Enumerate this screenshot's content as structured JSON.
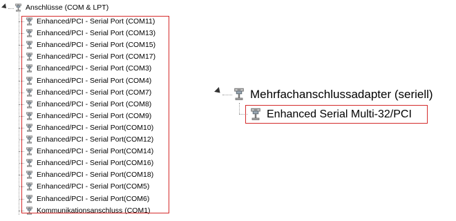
{
  "left_tree": {
    "parent_label": "Anschlüsse (COM & LPT)",
    "children": [
      "Enhanced/PCI - Serial Port (COM11)",
      "Enhanced/PCI - Serial Port (COM13)",
      "Enhanced/PCI - Serial Port (COM15)",
      "Enhanced/PCI - Serial Port (COM17)",
      "Enhanced/PCI - Serial Port (COM3)",
      "Enhanced/PCI - Serial Port (COM4)",
      "Enhanced/PCI - Serial Port (COM7)",
      "Enhanced/PCI - Serial Port (COM8)",
      "Enhanced/PCI - Serial Port (COM9)",
      "Enhanced/PCI - Serial Port(COM10)",
      "Enhanced/PCI - Serial Port(COM12)",
      "Enhanced/PCI - Serial Port(COM14)",
      "Enhanced/PCI - Serial Port(COM16)",
      "Enhanced/PCI - Serial Port(COM18)",
      "Enhanced/PCI - Serial Port(COM5)",
      "Enhanced/PCI - Serial Port(COM6)",
      "Kommunikationsanschluss (COM1)"
    ],
    "highlighted_count": 16
  },
  "right_tree": {
    "parent_label": "Mehrfachanschlussadapter (seriell)",
    "child_label": "Enhanced Serial Multi-32/PCI"
  },
  "icons": {
    "expander": "expanded-triangle-icon",
    "device": "serial-port-icon"
  },
  "colors": {
    "highlight": "#d42a2a"
  }
}
